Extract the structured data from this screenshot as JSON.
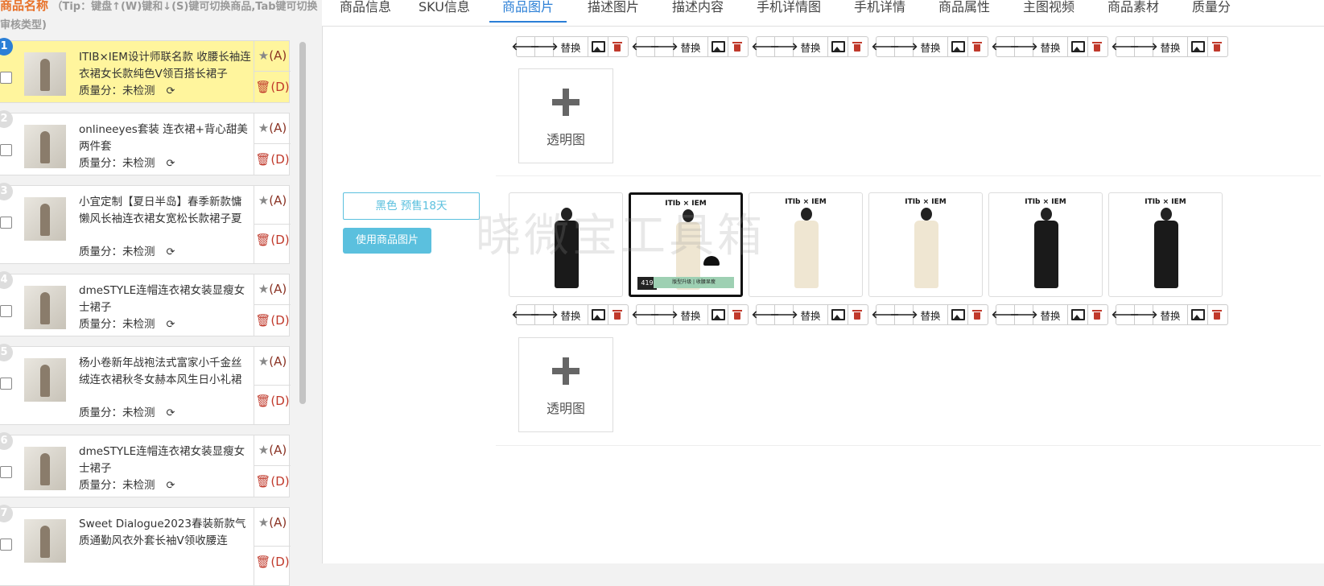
{
  "left": {
    "header_title": "商品名称",
    "header_tip": "（Tip：键盘↑(W)键和↓(S)键可切换商品,Tab键可切换审核类型)",
    "items": [
      {
        "num": "1",
        "title": "ITIB×IEM设计师联名款 收腰长袖连衣裙女长款纯色V领百搭长裙子",
        "quality": "质量分：未检测",
        "star": "(A)",
        "del": "(D)"
      },
      {
        "num": "2",
        "title": "onlineeyes套装 连衣裙+背心甜美两件套",
        "quality": "质量分：未检测",
        "star": "(A)",
        "del": "(D)"
      },
      {
        "num": "3",
        "title": "小宜定制【夏日半岛】春季新款慵懒风长袖连衣裙女宽松长款裙子夏",
        "quality": "质量分：未检测",
        "star": "(A)",
        "del": "(D)"
      },
      {
        "num": "4",
        "title": "dmeSTYLE连帽连衣裙女装显瘦女士裙子",
        "quality": "质量分：未检测",
        "star": "(A)",
        "del": "(D)"
      },
      {
        "num": "5",
        "title": "杨小卷新年战袍法式富家小千金丝绒连衣裙秋冬女赫本风生日小礼裙",
        "quality": "质量分：未检测",
        "star": "(A)",
        "del": "(D)"
      },
      {
        "num": "6",
        "title": "dmeSTYLE连帽连衣裙女装显瘦女士裙子",
        "quality": "质量分：未检测",
        "star": "(A)",
        "del": "(D)"
      },
      {
        "num": "7",
        "title": "Sweet Dialogue2023春装新款气质通勤风衣外套长袖V领收腰连",
        "quality": "",
        "star": "(A)",
        "del": "(D)"
      }
    ]
  },
  "tabs": [
    "商品信息",
    "SKU信息",
    "商品图片",
    "描述图片",
    "描述内容",
    "手机详情图",
    "手机详情",
    "商品属性",
    "主图视频",
    "商品素材",
    "质量分"
  ],
  "toolbar": {
    "replace": "替换"
  },
  "add_label": "透明图",
  "sku": {
    "label": "黑色 预售18天",
    "use_button": "使用商品图片"
  },
  "pictures": [
    {
      "brand": "",
      "style": "black"
    },
    {
      "brand": "ITIb × IEM",
      "style": "cream-framed",
      "price": "419",
      "band": "版型升级 | 收腰显瘦"
    },
    {
      "brand": "ITIb × IEM",
      "style": "cream"
    },
    {
      "brand": "ITIb × IEM",
      "style": "cream"
    },
    {
      "brand": "ITIb × IEM",
      "style": "black"
    },
    {
      "brand": "ITIb × IEM",
      "style": "black"
    }
  ],
  "watermark": "晓微宝工具箱",
  "colors": {
    "accent": "#2b7fd6",
    "active_item": "#fff59d",
    "header_orange": "#e8722a",
    "sku_blue": "#5bc0de",
    "delete_red": "#c0392b"
  }
}
